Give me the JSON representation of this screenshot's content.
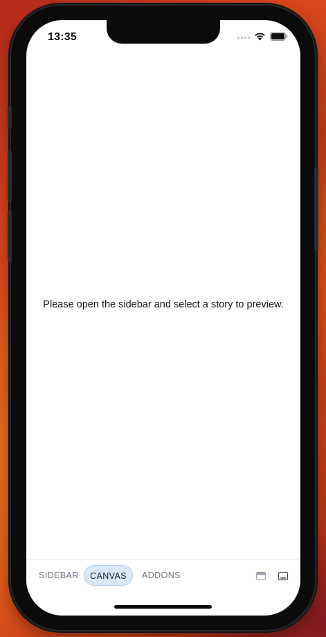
{
  "status_bar": {
    "time": "13:35",
    "icons": [
      "cellular-signal-icon",
      "wifi-icon",
      "battery-icon"
    ]
  },
  "canvas": {
    "message": "Please open the sidebar and select a story to preview."
  },
  "tabbar": {
    "tabs": [
      {
        "label": "SIDEBAR",
        "active": false
      },
      {
        "label": "CANVAS",
        "active": true
      },
      {
        "label": "ADDONS",
        "active": false
      }
    ],
    "icons": [
      "toggle-top-panel-icon",
      "toggle-bottom-panel-icon"
    ]
  },
  "colors": {
    "active_tab_bg": "#dbe8f6",
    "active_tab_border": "#b7cde6",
    "inactive_tab_text": "#6b7280",
    "wallpaper": "#d9461c"
  }
}
